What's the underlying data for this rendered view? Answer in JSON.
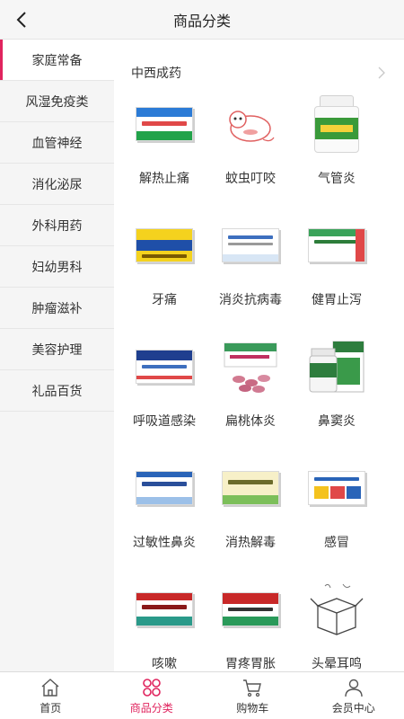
{
  "header": {
    "title": "商品分类"
  },
  "sidebar": {
    "items": [
      {
        "label": "家庭常备"
      },
      {
        "label": "风湿免疫类"
      },
      {
        "label": "血管神经"
      },
      {
        "label": "消化泌尿"
      },
      {
        "label": "外科用药"
      },
      {
        "label": "妇幼男科"
      },
      {
        "label": "肿瘤滋补"
      },
      {
        "label": "美容护理"
      },
      {
        "label": "礼品百货"
      }
    ],
    "active_index": 0
  },
  "section": {
    "title": "中西成药",
    "items": [
      {
        "label": "解热止痛",
        "icon": "medicine-box-blue-green-icon"
      },
      {
        "label": "蚊虫叮咬",
        "icon": "cartoon-bug-icon"
      },
      {
        "label": "气管炎",
        "icon": "green-medicine-bottle-icon"
      },
      {
        "label": "牙痛",
        "icon": "yellow-medicine-box-icon"
      },
      {
        "label": "消炎抗病毒",
        "icon": "white-medicine-box-icon"
      },
      {
        "label": "健胃止泻",
        "icon": "green-stripe-medicine-box-icon"
      },
      {
        "label": "呼吸道感染",
        "icon": "blue-medicine-box-icon"
      },
      {
        "label": "扁桃体炎",
        "icon": "pink-pills-box-icon"
      },
      {
        "label": "鼻窦炎",
        "icon": "green-bottle-and-box-icon"
      },
      {
        "label": "过敏性鼻炎",
        "icon": "blue-stripe-medicine-box-icon"
      },
      {
        "label": "消热解毒",
        "icon": "yellow-green-medicine-box-icon"
      },
      {
        "label": "感冒",
        "icon": "colorful-medicine-box-icon"
      },
      {
        "label": "咳嗽",
        "icon": "red-medicine-box-icon"
      },
      {
        "label": "胃疼胃胀",
        "icon": "red-green-medicine-box-icon"
      },
      {
        "label": "头晕耳鸣",
        "icon": "empty-box-placeholder-icon"
      }
    ]
  },
  "tabbar": {
    "items": [
      {
        "label": "首页",
        "icon": "home-icon"
      },
      {
        "label": "商品分类",
        "icon": "category-icon"
      },
      {
        "label": "购物车",
        "icon": "cart-icon"
      },
      {
        "label": "会员中心",
        "icon": "user-icon"
      }
    ],
    "active_index": 1
  },
  "colors": {
    "accent": "#e0245e",
    "sidebar_bg": "#f5f5f5",
    "header_bg": "#f6f6f6"
  }
}
